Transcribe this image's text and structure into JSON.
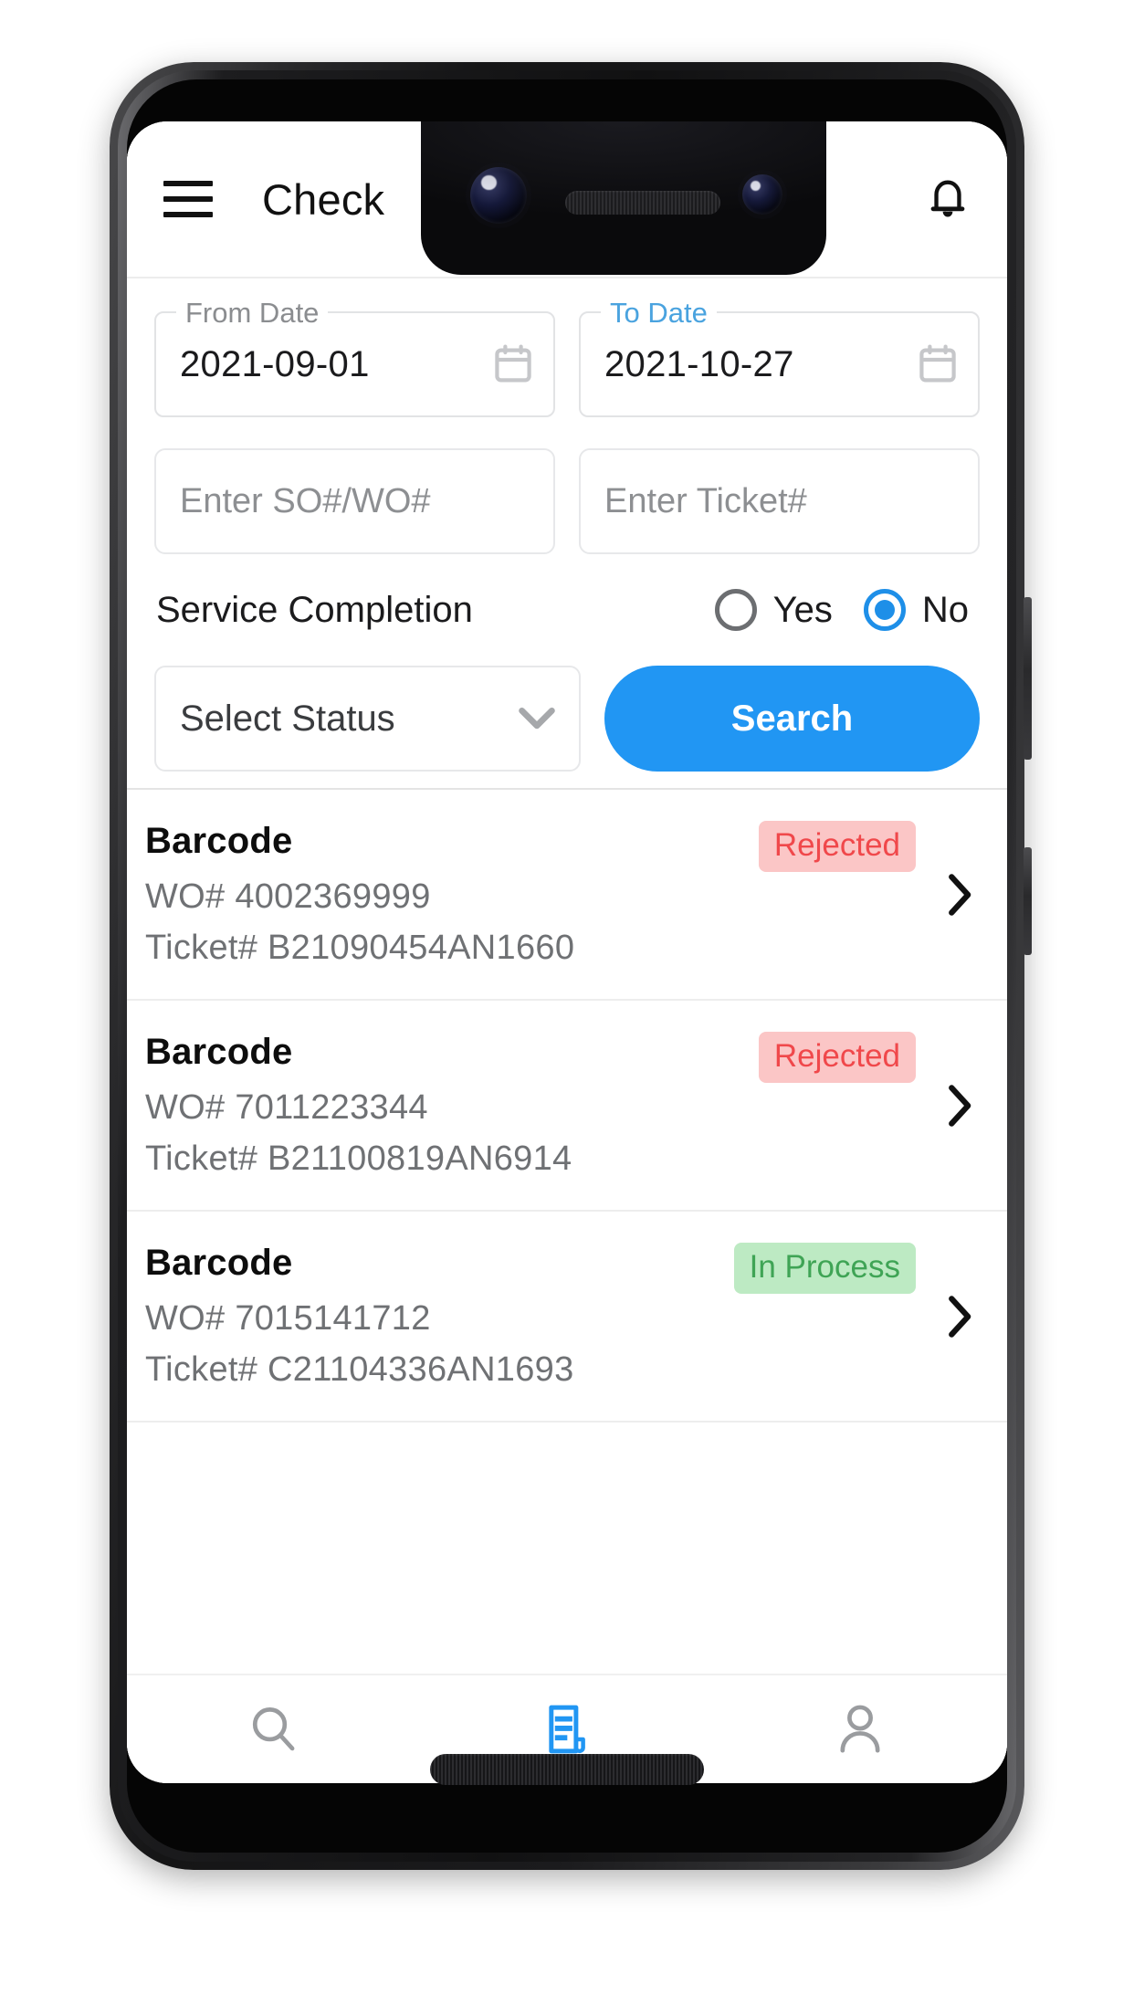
{
  "app": {
    "title": "Check ",
    "menu_icon": "hamburger-menu-icon",
    "notification_icon": "bell-icon"
  },
  "search_form": {
    "from_date": {
      "label": "From Date",
      "value": "2021-09-01",
      "icon": "calendar-icon",
      "label_focused": false
    },
    "to_date": {
      "label": "To Date",
      "value": "2021-10-27",
      "icon": "calendar-icon",
      "label_focused": true
    },
    "so_wo_input": {
      "value": "",
      "placeholder": "Enter SO#/WO#"
    },
    "ticket_input": {
      "value": "",
      "placeholder": "Enter Ticket#"
    },
    "service_completion": {
      "label": "Service Completion",
      "options": [
        {
          "label": "Yes",
          "selected": false
        },
        {
          "label": "No",
          "selected": true
        }
      ]
    },
    "status_select": {
      "value": "Select Status",
      "icon": "chevron-down-icon"
    },
    "search_button": {
      "label": "Search"
    }
  },
  "results": [
    {
      "title": "Barcode",
      "wo": "WO# 4002369999",
      "ticket": "Ticket# B21090454AN1660",
      "status": "Rejected",
      "status_type": "rejected"
    },
    {
      "title": "Barcode",
      "wo": "WO# 7011223344",
      "ticket": "Ticket# B21100819AN6914",
      "status": "Rejected",
      "status_type": "rejected"
    },
    {
      "title": "Barcode",
      "wo": "WO# 7015141712",
      "ticket": "Ticket# C21104336AN1693",
      "status": "In Process",
      "status_type": "inprocess"
    }
  ],
  "bottom_nav": [
    {
      "icon": "search-icon",
      "active": false
    },
    {
      "icon": "document-list-icon",
      "active": true
    },
    {
      "icon": "person-icon",
      "active": false
    }
  ],
  "colors": {
    "accent": "#2196f3",
    "label_focused": "#4aa3df",
    "badge_rejected_bg": "#fbc6c6",
    "badge_rejected_text": "#f0484b",
    "badge_inprocess_bg": "#bdeac3",
    "badge_inprocess_text": "#3fa455",
    "text_primary": "#1b1b1d",
    "text_secondary": "#6f7174"
  }
}
